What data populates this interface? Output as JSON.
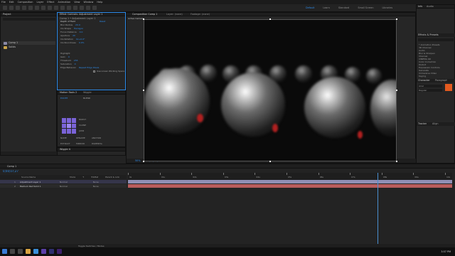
{
  "menubar": {
    "items": [
      "File",
      "Edit",
      "Composition",
      "Layer",
      "Effect",
      "Animation",
      "View",
      "Window",
      "Help"
    ]
  },
  "workspaces": {
    "items": [
      "Default",
      "Learn",
      "Standard",
      "Small Screen",
      "Libraries"
    ],
    "active": "Default"
  },
  "project_panel": {
    "title": "Project",
    "items": [
      "Comp 1",
      "Solids"
    ]
  },
  "effects_panel": {
    "tab": "Effect Controls: Adjustment Layer 1",
    "comp_line": "Comp 1 • Adjustment Layer 1",
    "effect_name": "Depth of Field",
    "reset": "Reset",
    "params": [
      {
        "label": "Blur Radius",
        "value": "20.0"
      },
      {
        "label": "Iris Shape",
        "value": "Hexagon"
      },
      {
        "label": "Focus Distance",
        "value": "0.0"
      },
      {
        "label": "Aperture",
        "value": "20"
      },
      {
        "label": "Iris Rotation",
        "value": "0x+0.0°"
      },
      {
        "label": "Iris Roundness",
        "value": "0.0%"
      },
      {
        "label": "Highlight",
        "value": ""
      },
      {
        "label": "Gain",
        "value": "0"
      },
      {
        "label": "Threshold",
        "value": "255"
      },
      {
        "label": "Saturation",
        "value": "0"
      },
      {
        "label": "Edge Behavior",
        "value": "Repeat Edge Pixels"
      }
    ],
    "checkbox_label": "Use Linear Working Space"
  },
  "motion_panel": {
    "title": "Motion Tools 2",
    "tab2": "Wiggle",
    "labels": [
      "EXCITE",
      "BLEND",
      "BURST",
      "CLONE",
      "JUMP",
      "NAME",
      "RENAME",
      "ANCHOR",
      "EXTRACT",
      "MIRROR",
      "PARENTAL"
    ]
  },
  "wiggle_panel": {
    "title": "Wiggle it"
  },
  "viewer": {
    "tab": "Composition Comp 1",
    "tab2": "Layer: (none)",
    "tab3": "Footage: (none)",
    "label": "Active Camera",
    "zoom": "50%",
    "timecode": "0;00;07;27",
    "resolution": "Full",
    "camera": "Active Camera",
    "view": "1 View"
  },
  "right_panel": {
    "info_title": "Info",
    "audio_title": "Audio",
    "effects_title": "Effects & Presets",
    "search_placeholder": "",
    "categories": [
      "* Animation Presets",
      "3D Channel",
      "Audio",
      "Blur & Sharpen",
      "Channel",
      "CINEMA 4D",
      "Color Correction",
      "Distort",
      "Expression Controls",
      "Generate",
      "Immersive Video",
      "Keying"
    ],
    "character_title": "Character",
    "paragraph_title": "Paragraph",
    "font": "Arial",
    "style": "Regular",
    "tracker_title": "Tracker",
    "align_title": "Align",
    "accent": "#e35a1f"
  },
  "timeline": {
    "tab": "Comp 1",
    "timecode": "0;00;07;27",
    "columns": [
      "Source Name",
      "Mode",
      "T",
      "TrkMat",
      "Parent & Link"
    ],
    "layers": [
      {
        "num": "1",
        "name": "Adjustment Layer 1",
        "mode": "Normal",
        "parent": "None"
      },
      {
        "num": "2",
        "name": "Medium Red Solid 1",
        "mode": "Normal",
        "parent": "None"
      }
    ],
    "ruler_labels": [
      "0s",
      "01s",
      "02s",
      "03s",
      "04s",
      "05s",
      "06s",
      "07s",
      "08s",
      "09s",
      "10s"
    ],
    "playhead_fraction": 0.77,
    "bottom_label": "Toggle Switches / Modes"
  },
  "taskbar": {
    "time": "3:57 PM",
    "icons": [
      "windows-icon",
      "search-icon",
      "task-view-icon",
      "file-explorer-icon",
      "browser-icon",
      "after-effects-icon",
      "media-encoder-icon",
      "premiere-icon"
    ]
  }
}
